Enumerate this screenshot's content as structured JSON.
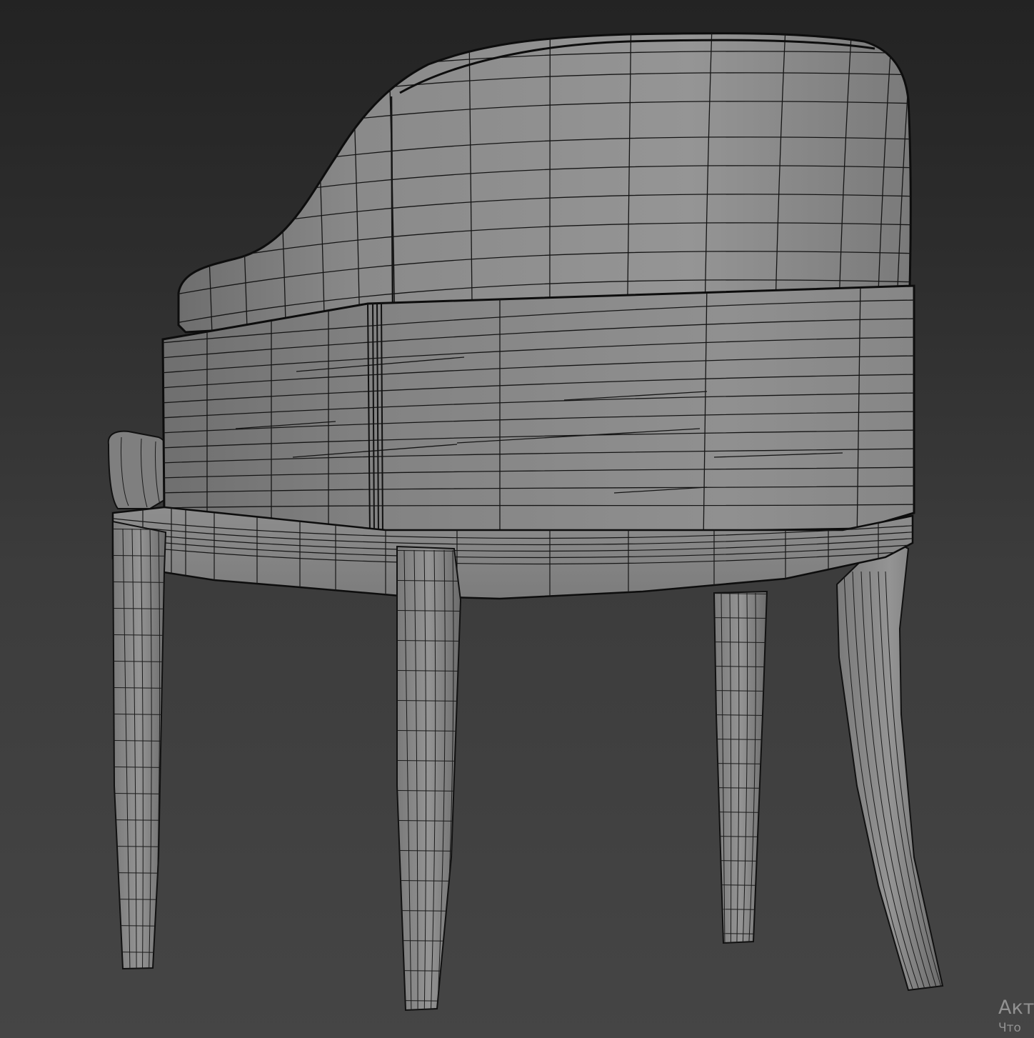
{
  "viewport": {
    "shading": "shaded-with-wireframe-edges",
    "background_colors": [
      "#232323",
      "#454545"
    ],
    "model_color": "#8d8d8d",
    "wire_color": "#111111"
  },
  "model": {
    "subject": "chair",
    "parts": [
      "backrest",
      "back-band",
      "armrest",
      "seat-rail",
      "front-left-leg",
      "front-right-leg",
      "back-left-leg",
      "back-right-leg"
    ]
  },
  "activation_watermark": {
    "title": "Акт",
    "subtitle": "Что"
  }
}
